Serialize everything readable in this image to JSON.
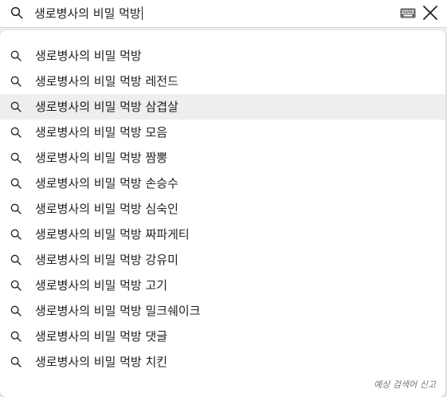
{
  "search": {
    "query": "생로병사의 비밀 먹방",
    "search_icon": "search-icon",
    "keyboard_icon": "keyboard-icon",
    "clear_icon": "close-icon"
  },
  "suggestions": [
    {
      "text": "생로병사의 비밀 먹방",
      "icon": "search-icon",
      "highlighted": false
    },
    {
      "text": "생로병사의 비밀 먹방 레전드",
      "icon": "search-icon",
      "highlighted": false
    },
    {
      "text": "생로병사의 비밀 먹방 삼겹살",
      "icon": "search-icon",
      "highlighted": true
    },
    {
      "text": "생로병사의 비밀 먹방 모음",
      "icon": "search-icon",
      "highlighted": false
    },
    {
      "text": "생로병사의 비밀 먹방 짬뽕",
      "icon": "search-icon",
      "highlighted": false
    },
    {
      "text": "생로병사의 비밀 먹방 손승수",
      "icon": "search-icon",
      "highlighted": false
    },
    {
      "text": "생로병사의 비밀 먹방 심숙인",
      "icon": "search-icon",
      "highlighted": false
    },
    {
      "text": "생로병사의 비밀 먹방 짜파게티",
      "icon": "search-icon",
      "highlighted": false
    },
    {
      "text": "생로병사의 비밀 먹방 강유미",
      "icon": "search-icon",
      "highlighted": false
    },
    {
      "text": "생로병사의 비밀 먹방 고기",
      "icon": "search-icon",
      "highlighted": false
    },
    {
      "text": "생로병사의 비밀 먹방 밀크쉐이크",
      "icon": "search-icon",
      "highlighted": false
    },
    {
      "text": "생로병사의 비밀 먹방 댓글",
      "icon": "search-icon",
      "highlighted": false
    },
    {
      "text": "생로병사의 비밀 먹방 치킨",
      "icon": "search-icon",
      "highlighted": false
    }
  ],
  "footer": {
    "report_label": "예상 검색어 신고"
  },
  "colors": {
    "highlight": "#eeeeee",
    "text": "#202124",
    "muted": "#70757a",
    "icon": "#202124"
  }
}
